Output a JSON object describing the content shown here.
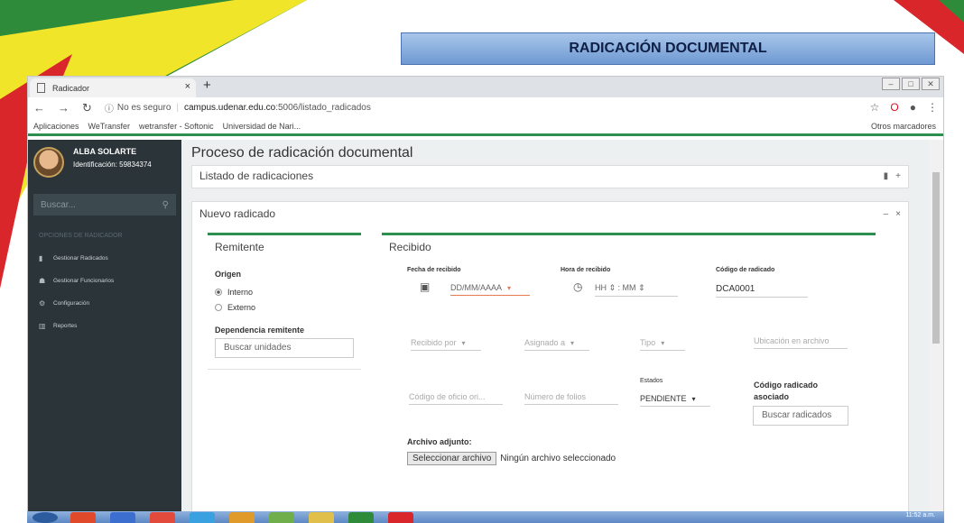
{
  "slide": {
    "title": "RADICACIÓN DOCUMENTAL"
  },
  "browser": {
    "tab_title": "Radicador",
    "tab_close": "×",
    "new_tab": "+",
    "security": "No es seguro",
    "url_host": "campus.udenar.edu.co",
    "url_path": ":5006/listado_radicados",
    "bookmarks": [
      "Aplicaciones",
      "WeTransfer",
      "wetransfer - Softonic",
      "Universidad de Nari..."
    ],
    "other_bookmarks": "Otros marcadores"
  },
  "sidebar": {
    "user_name": "ALBA SOLARTE",
    "user_id": "Identificación: 59834374",
    "search_placeholder": "Buscar...",
    "section": "OPCIONES DE RADICADOR",
    "items": [
      {
        "label": "Gestionar Radicados",
        "icon": "book-icon"
      },
      {
        "label": "Gestionar Funcionarios",
        "icon": "users-icon"
      },
      {
        "label": "Configuración",
        "icon": "gears-icon"
      },
      {
        "label": "Reportes",
        "icon": "chart-icon"
      }
    ]
  },
  "main": {
    "title": "Proceso de radicación documental",
    "list_panel": "Listado de radicaciones",
    "new_panel": "Nuevo radicado",
    "remitente": {
      "title": "Remitente",
      "origen_label": "Origen",
      "options": [
        "Interno",
        "Externo"
      ],
      "selected": "Interno",
      "dependencia_label": "Dependencia remitente",
      "dependencia_placeholder": "Buscar unidades"
    },
    "recibido": {
      "title": "Recibido",
      "fecha_label": "Fecha de recibido",
      "fecha_value": "DD/MM/AAAA",
      "hora_label": "Hora de recibido",
      "hora_hh": "HH",
      "hora_mm": "MM",
      "codigo_label": "Código de radicado",
      "codigo_value": "DCA0001",
      "recibido_por": "Recibido por",
      "asignado_a": "Asignado a",
      "tipo": "Tipo",
      "ubicacion": "Ubicación en archivo",
      "codigo_oficio": "Código de oficio ori...",
      "numero_folios": "Número de folios",
      "estados_label": "Estados",
      "estado_value": "PENDIENTE",
      "codigo_asociado_label": "Código radicado asociado",
      "codigo_asociado_btn": "Buscar radicados",
      "archivo_label": "Archivo adjunto:",
      "archivo_btn": "Seleccionar archivo",
      "archivo_status": "Ningún archivo seleccionado"
    }
  },
  "taskbar": {
    "clock": "11:52 a.m."
  }
}
